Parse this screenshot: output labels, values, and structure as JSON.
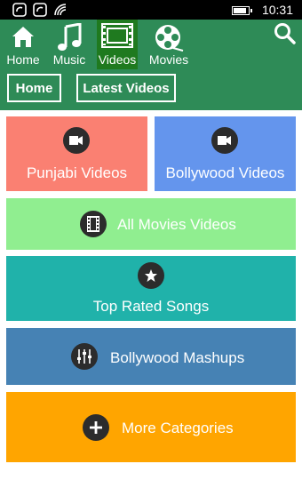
{
  "status": {
    "time": "10:31",
    "battery_level": 0.9
  },
  "nav": {
    "items": [
      {
        "label": "Home",
        "icon": "home-icon"
      },
      {
        "label": "Music",
        "icon": "music-note-icon"
      },
      {
        "label": "Videos",
        "icon": "film-icon",
        "active": true
      },
      {
        "label": "Movies",
        "icon": "film-reel-icon"
      }
    ],
    "search_icon": "search-icon"
  },
  "subnav": {
    "home_label": "Home",
    "latest_label": "Latest Videos"
  },
  "tiles": [
    {
      "label": "Punjabi Videos",
      "icon": "video-camera-icon",
      "color": "#fa8072"
    },
    {
      "label": "Bollywood Videos",
      "icon": "video-camera-icon",
      "color": "#6495ed"
    },
    {
      "label": "All Movies Videos",
      "icon": "film-strip-icon",
      "color": "#90ee90"
    },
    {
      "label": "Top Rated Songs",
      "icon": "star-icon",
      "color": "#20b2aa"
    },
    {
      "label": "Bollywood Mashups",
      "icon": "equalizer-icon",
      "color": "#4682b4"
    },
    {
      "label": "More Categories",
      "icon": "plus-icon",
      "color": "#ffa500"
    }
  ],
  "colors": {
    "appbar": "#2e8b57",
    "active_nav": "#1f7a1f",
    "icon_circle": "#2c2c2c"
  }
}
